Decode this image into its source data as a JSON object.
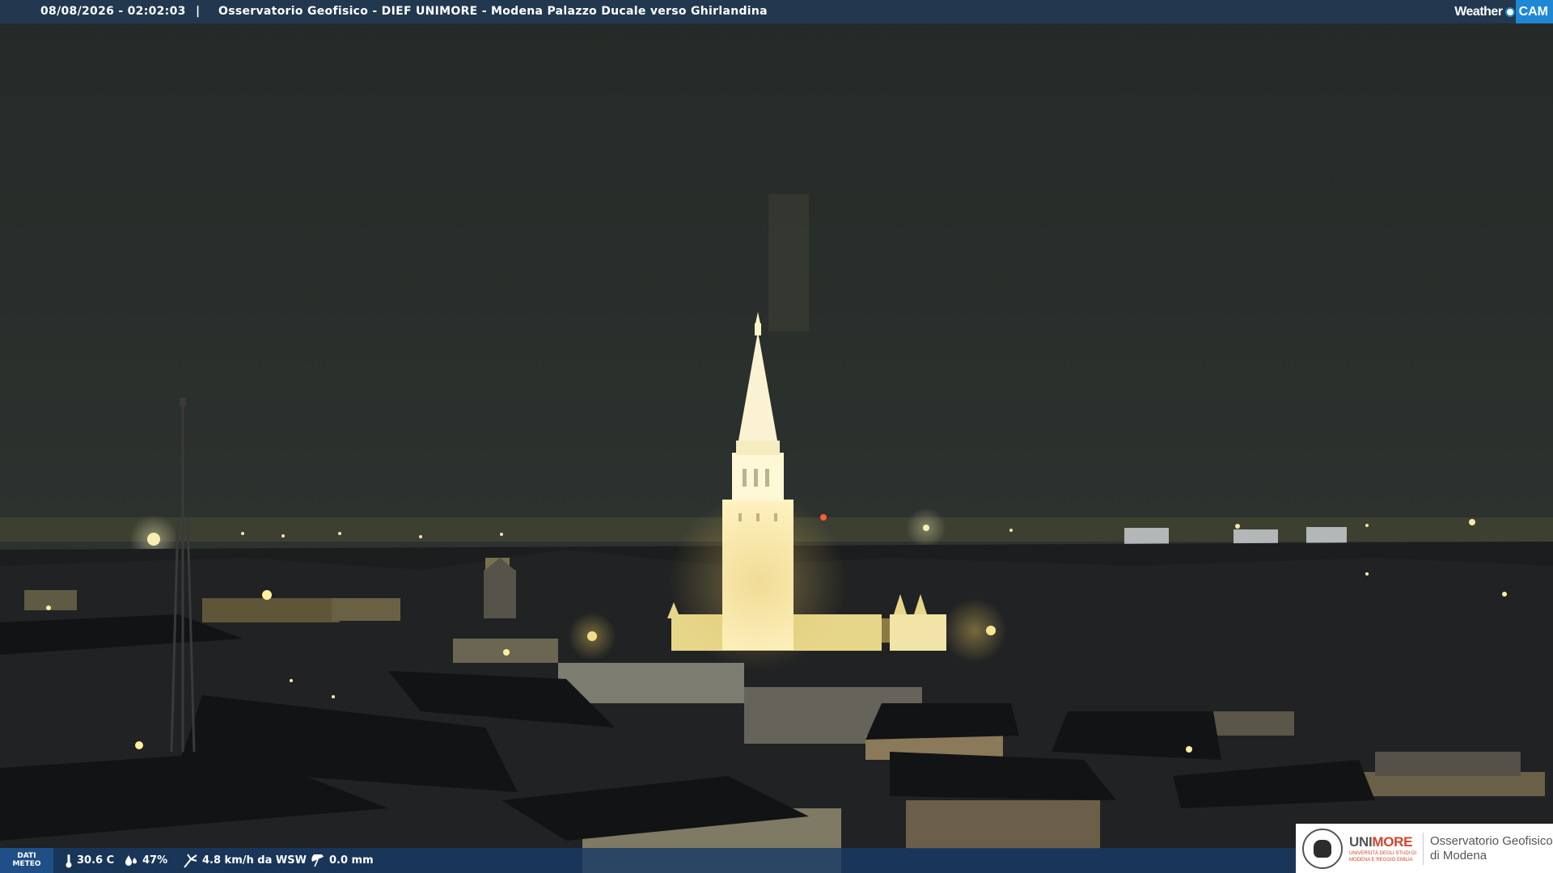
{
  "header": {
    "timestamp": "08/08/2026 - 02:02:03",
    "separator": "|",
    "title": "Osservatorio Geofisico - DIEF UNIMORE - Modena Palazzo Ducale verso Ghirlandina"
  },
  "logo": {
    "weather": "Weather",
    "cam": "CAM"
  },
  "meteo": {
    "label_line1": "DATI",
    "label_line2": "METEO",
    "temperature": "30.6 C",
    "humidity": "47%",
    "wind": "4.8 km/h da WSW",
    "rain": "0.0 mm"
  },
  "institution": {
    "name_part1": "UNI",
    "name_part2": "MORE",
    "sub_line1": "UNIVERSITÀ DEGLI STUDI DI",
    "sub_line2": "MODENA E REGGIO EMILIA",
    "observatory_line1": "Osservatorio Geofisico",
    "observatory_line2": "di Modena"
  },
  "colors": {
    "sky": "#2a2f2c",
    "bar": "#22384f",
    "accent": "#1e88d6",
    "tower_light": "#fff3c2",
    "unimore_red": "#d5442b"
  }
}
